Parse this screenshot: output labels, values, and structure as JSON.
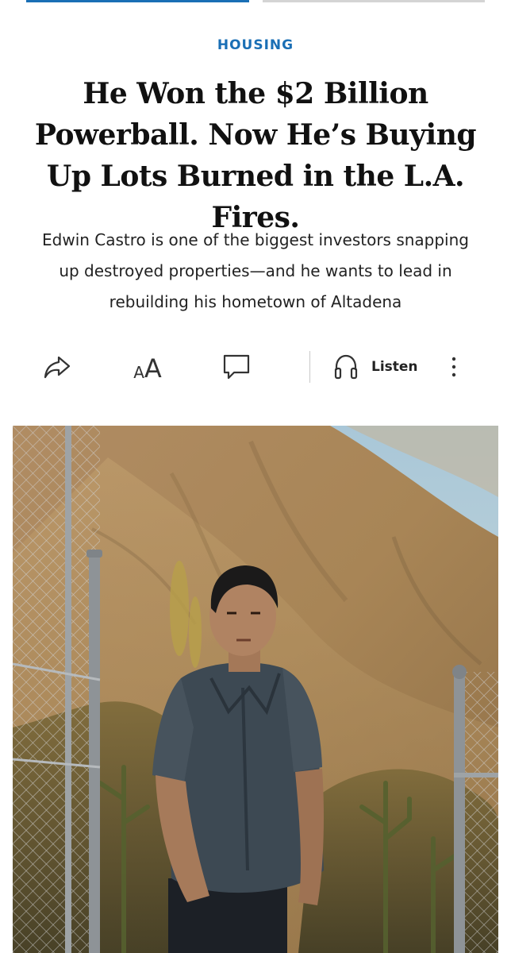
{
  "colors": {
    "section": "#1a6fb5",
    "progress_active": "#1a6fb5",
    "progress_inactive": "#d4d4d4",
    "headline": "#111111",
    "icon": "#333333"
  },
  "article": {
    "section": "HOUSING",
    "headline": "He Won the $2 Billion Powerball. Now He’s Buying Up Lots Burned in the L.A. Fires.",
    "dek": "Edwin Castro is one of the biggest investors snapping up destroyed properties—and he wants to lead in rebuilding his hometown of Altadena"
  },
  "toolbar": {
    "share_icon": "share-arrow-icon",
    "font_icon": "font-size-icon",
    "font_glyph_small": "A",
    "font_glyph_big": "A",
    "comment_icon": "comment-bubble-icon",
    "listen_icon": "headphones-icon",
    "listen_label": "Listen",
    "more_icon": "vertical-ellipsis-icon"
  },
  "hero_image": {
    "description_icon": "photo",
    "subject": "man in gray short-sleeve shirt standing by chain-link fence in front of dry hillside"
  }
}
